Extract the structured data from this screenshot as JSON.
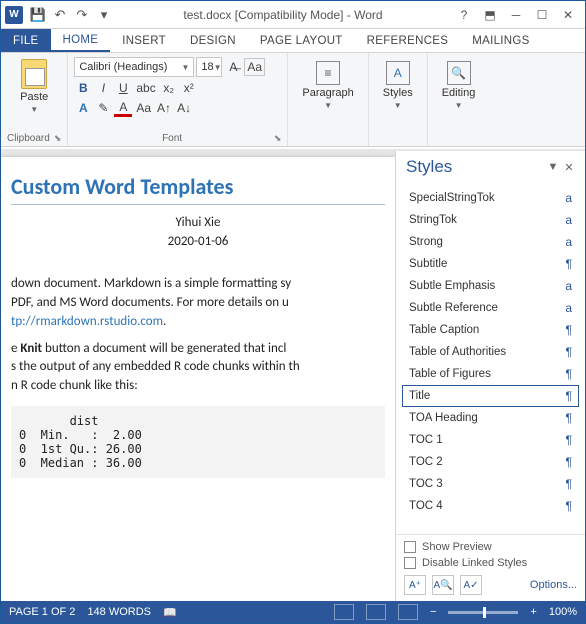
{
  "title": "test.docx [Compatibility Mode] - Word",
  "tabs": [
    "FILE",
    "HOME",
    "INSERT",
    "DESIGN",
    "PAGE LAYOUT",
    "REFERENCES",
    "MAILINGS"
  ],
  "active_tab": 1,
  "font": {
    "name": "Calibri (Headings)",
    "size": "18"
  },
  "groups": {
    "clipboard": "Clipboard",
    "font": "Font",
    "paragraph": "Paragraph",
    "styles": "Styles",
    "editing": "Editing",
    "paste": "Paste"
  },
  "doc": {
    "title": "Custom Word Templates",
    "author": "Yihui Xie",
    "date": "2020-01-06",
    "p1": "down document. Markdown is a simple formatting sy",
    "p2": "PDF, and MS Word documents. For more details on u",
    "link": "tp://rmarkdown.rstudio.com",
    "p3a": "e ",
    "p3b": "Knit",
    "p3c": " button a document will be generated that incl",
    "p4": "s the output of any embedded R code chunks within th",
    "p5": "n R code chunk like this:",
    "code": "       dist\n0  Min.   :  2.00\n0  1st Qu.: 26.00\n0  Median : 36.00"
  },
  "styles_pane": {
    "title": "Styles",
    "items": [
      {
        "name": "SpecialStringTok",
        "mark": "a"
      },
      {
        "name": "StringTok",
        "mark": "a"
      },
      {
        "name": "Strong",
        "mark": "a"
      },
      {
        "name": "Subtitle",
        "mark": "¶"
      },
      {
        "name": "Subtle Emphasis",
        "mark": "a"
      },
      {
        "name": "Subtle Reference",
        "mark": "a"
      },
      {
        "name": "Table Caption",
        "mark": "¶"
      },
      {
        "name": "Table of Authorities",
        "mark": "¶"
      },
      {
        "name": "Table of Figures",
        "mark": "¶"
      },
      {
        "name": "Title",
        "mark": "¶",
        "selected": true
      },
      {
        "name": "TOA Heading",
        "mark": "¶"
      },
      {
        "name": "TOC 1",
        "mark": "¶"
      },
      {
        "name": "TOC 2",
        "mark": "¶"
      },
      {
        "name": "TOC 3",
        "mark": "¶"
      },
      {
        "name": "TOC 4",
        "mark": "¶"
      }
    ],
    "show_preview": "Show Preview",
    "disable_linked": "Disable Linked Styles",
    "options": "Options..."
  },
  "status": {
    "page": "PAGE 1 OF 2",
    "words": "148 WORDS",
    "zoom": "100%"
  }
}
